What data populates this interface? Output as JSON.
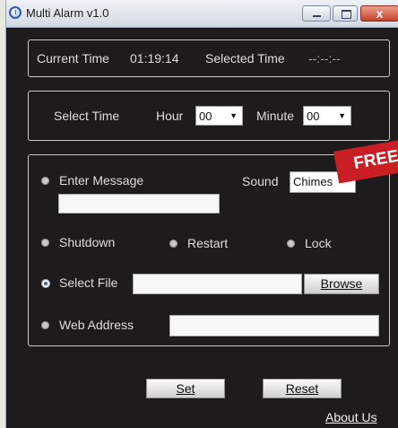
{
  "window": {
    "title": "Multi Alarm v1.0",
    "close_glyph": "x"
  },
  "status": {
    "current_time_label": "Current Time",
    "current_time_value": "01:19:14",
    "selected_time_label": "Selected Time",
    "selected_time_value": "--:--:--"
  },
  "select_time": {
    "label": "Select Time",
    "hour_label": "Hour",
    "hour_value": "00",
    "minute_label": "Minute",
    "minute_value": "00"
  },
  "options": {
    "enter_message_label": "Enter Message",
    "message_value": "",
    "sound_label": "Sound",
    "sound_value": "Chimes",
    "shutdown_label": "Shutdown",
    "restart_label": "Restart",
    "lock_label": "Lock",
    "select_file_label": "Select File",
    "file_value": "",
    "browse_label": "Browse",
    "web_address_label": "Web Address",
    "web_address_value": "",
    "selected_option": "select_file"
  },
  "buttons": {
    "set_label": "Set",
    "reset_label": "Reset"
  },
  "footer": {
    "about_label": "About Us"
  },
  "ribbon": {
    "text": "FREE"
  },
  "colors": {
    "background": "#1e1b1c",
    "ribbon": "#c81e24",
    "radio_selected": "#3f66a0"
  }
}
